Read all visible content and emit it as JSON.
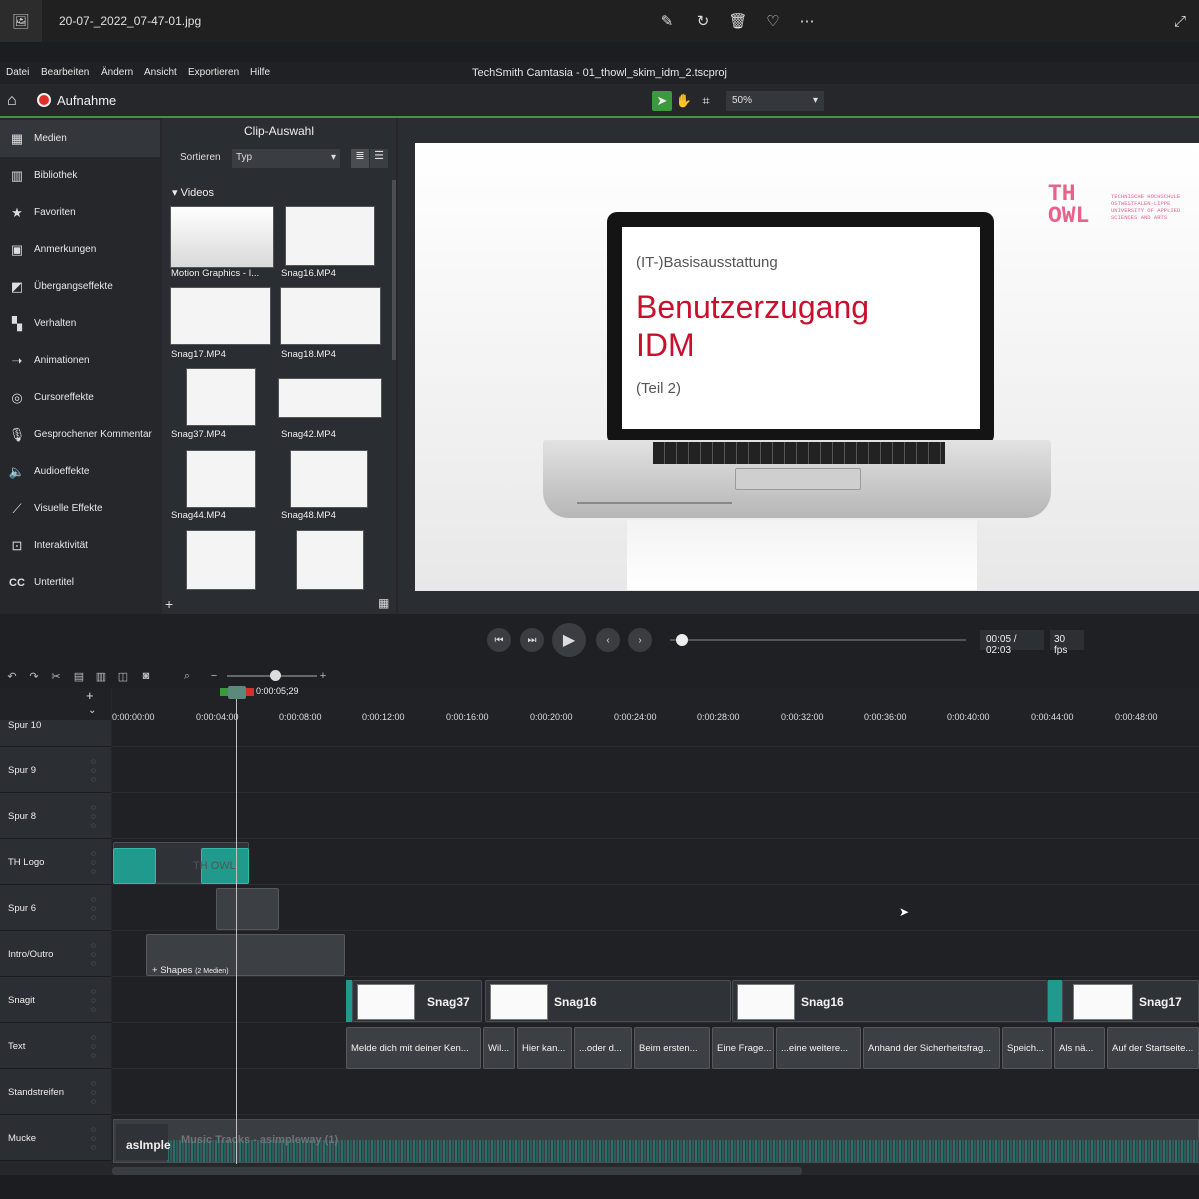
{
  "viewer": {
    "filename": "20-07-_2022_07-47-01.jpg",
    "icons": [
      "edit-image-icon",
      "rotate-icon",
      "trash-icon",
      "heart-icon",
      "more-icon",
      "expand-icon"
    ]
  },
  "menu": {
    "items": [
      "Datei",
      "Bearbeiten",
      "Ändern",
      "Ansicht",
      "Exportieren",
      "Hilfe"
    ],
    "title": "TechSmith Camtasia - 01_thowl_skim_idm_2.tscproj"
  },
  "toolbar": {
    "record_label": "Aufnahme",
    "zoom": "50%",
    "accent": "#3c9a3c"
  },
  "sidebar": {
    "items": [
      "Medien",
      "Bibliothek",
      "Favoriten",
      "Anmerkungen",
      "Übergangseffekte",
      "Verhalten",
      "Animationen",
      "Cursoreffekte",
      "Gesprochener Kommentar",
      "Audioeffekte",
      "Visuelle Effekte",
      "Interaktivität",
      "Untertitel"
    ],
    "cc_glyph": "CC"
  },
  "clip_panel": {
    "title": "Clip-Auswahl",
    "sort_label": "Sortieren",
    "sort_value": "Typ",
    "group": "Videos",
    "clips": [
      "Motion Graphics - I...",
      "Snag16.MP4",
      "Snag17.MP4",
      "Snag18.MP4",
      "Snag37.MP4",
      "Snag42.MP4",
      "Snag44.MP4",
      "Snag48.MP4"
    ]
  },
  "slide": {
    "subtitle": "(IT-)Basisausstattung",
    "title_line1": "Benutzerzugang",
    "title_line2": "IDM",
    "part": "(Teil 2)",
    "logo_line1": "TH",
    "logo_line2": "OWL",
    "logo_text": "TECHNISCHE HOCHSCHULE OSTWESTFALEN-LIPPE UNIVERSITY OF APPLIED SCIENCES AND ARTS",
    "logo_color": "#e9628b",
    "title_color": "#c8102e"
  },
  "player": {
    "time": "00:05 / 02:03",
    "fps": "30 fps",
    "progress": 0.04
  },
  "timeline": {
    "playhead": "0:00:05;29",
    "ticks": [
      "0:00:00;00",
      "0:00:04;00",
      "0:00:08;00",
      "0:00:12;00",
      "0:00:16;00",
      "0:00:20;00",
      "0:00:24;00",
      "0:00:28;00",
      "0:00:32;00",
      "0:00:36;00",
      "0:00:40;00",
      "0:00:44;00",
      "0:00:48;00"
    ],
    "tracks": [
      "Spur 10",
      "Spur 9",
      "Spur 8",
      "TH Logo",
      "Spur 6",
      "Intro/Outro",
      "Snagit",
      "Text",
      "Standstreifen",
      "Mucke"
    ],
    "shapes_label": "Shapes",
    "shapes_count": "(2 Medien)",
    "logo_clip_text": "TH OWL",
    "snag_clips": [
      "Snag37",
      "Snag16",
      "Snag16",
      "Snag17"
    ],
    "text_clips": [
      "Melde dich mit deiner Ken...",
      "Wil...",
      "Hier kan...",
      "...oder d...",
      "Beim ersten...",
      "Eine Frage...",
      "...eine weitere...",
      "Anhand der Sicherheitsfrag...",
      "Speich...",
      "Als nä...",
      "Auf der Startseite..."
    ],
    "audio_clip": "asImple",
    "audio_label": "Music Tracks - asimpleway (1)"
  }
}
